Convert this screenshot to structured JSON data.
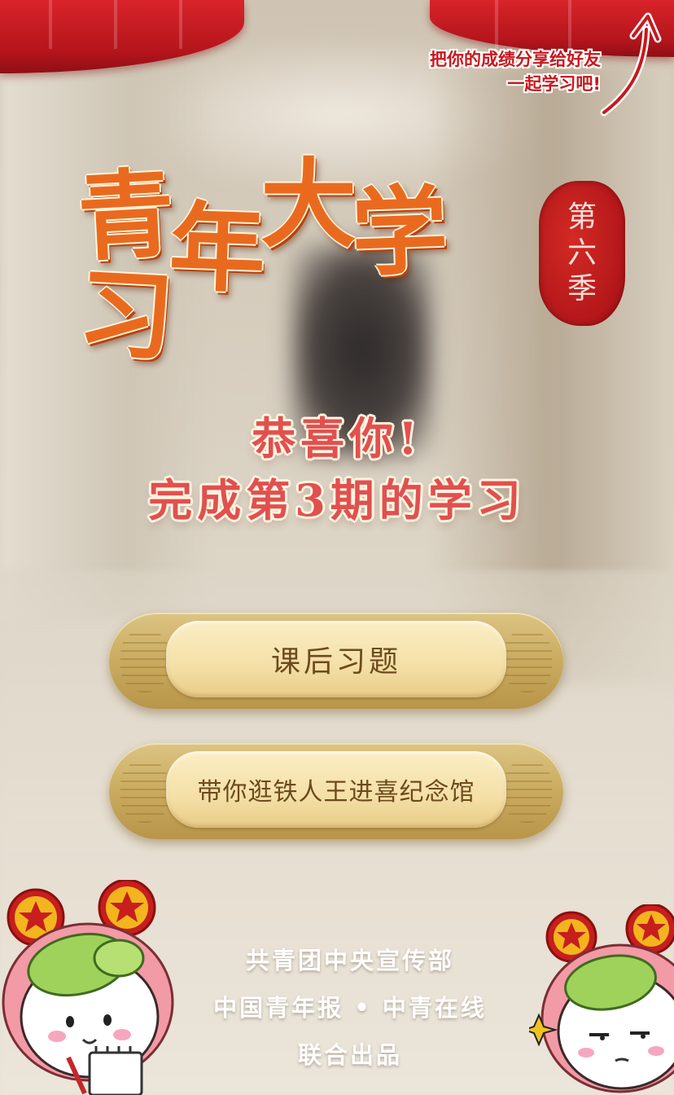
{
  "share_hint": {
    "line1": "把你的成绩分享给好友",
    "line2": "一起学习吧!"
  },
  "title": {
    "chars": [
      "青",
      "年",
      "大",
      "学",
      "习"
    ]
  },
  "seal": {
    "chars": [
      "第",
      "六",
      "季"
    ]
  },
  "congrats": {
    "line1": "恭喜你!",
    "line2": "完成第3期的学习"
  },
  "buttons": {
    "exercise_label": "课后习题",
    "tour_label": "带你逛铁人王进喜纪念馆"
  },
  "credits": {
    "line1": "共青团中央宣传部",
    "line2": "中国青年报 • 中青在线",
    "line3": "联合出品"
  },
  "colors": {
    "curtain_red": "#c8181e",
    "title_orange": "#e96a1f",
    "congrats_red": "#e1504f",
    "button_gold": "#c9ab5f",
    "button_text": "#6e4a1e"
  }
}
